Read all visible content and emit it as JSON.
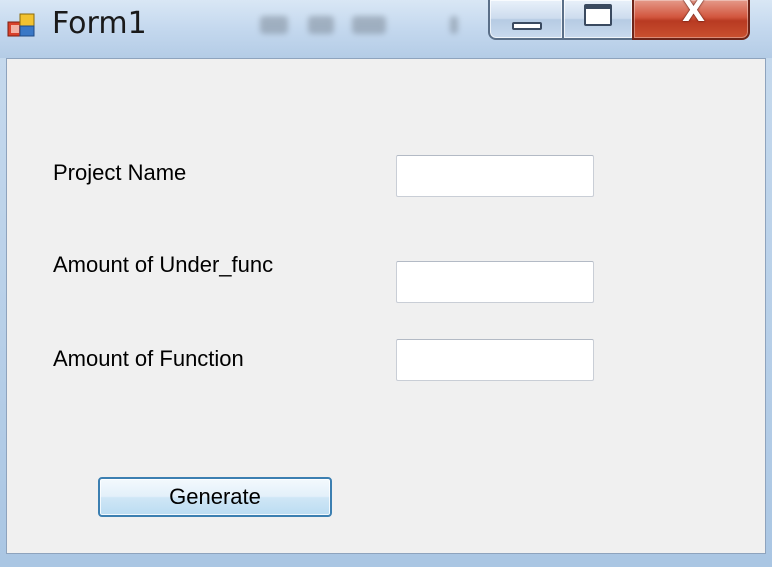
{
  "window": {
    "title": "Form1",
    "close_glyph": "X",
    "icons": {
      "app": "form-app-icon",
      "minimize": "minimize-icon",
      "maximize": "maximize-icon",
      "close": "close-icon"
    }
  },
  "form": {
    "fields": [
      {
        "label": "Project Name",
        "value": ""
      },
      {
        "label": "Amount of Under_func",
        "value": ""
      },
      {
        "label": "Amount of Function",
        "value": ""
      }
    ],
    "generate_label": "Generate"
  },
  "colors": {
    "client_background": "#f0f0f0",
    "close_button": "#c9502f",
    "button_border": "#3c7fb1"
  }
}
